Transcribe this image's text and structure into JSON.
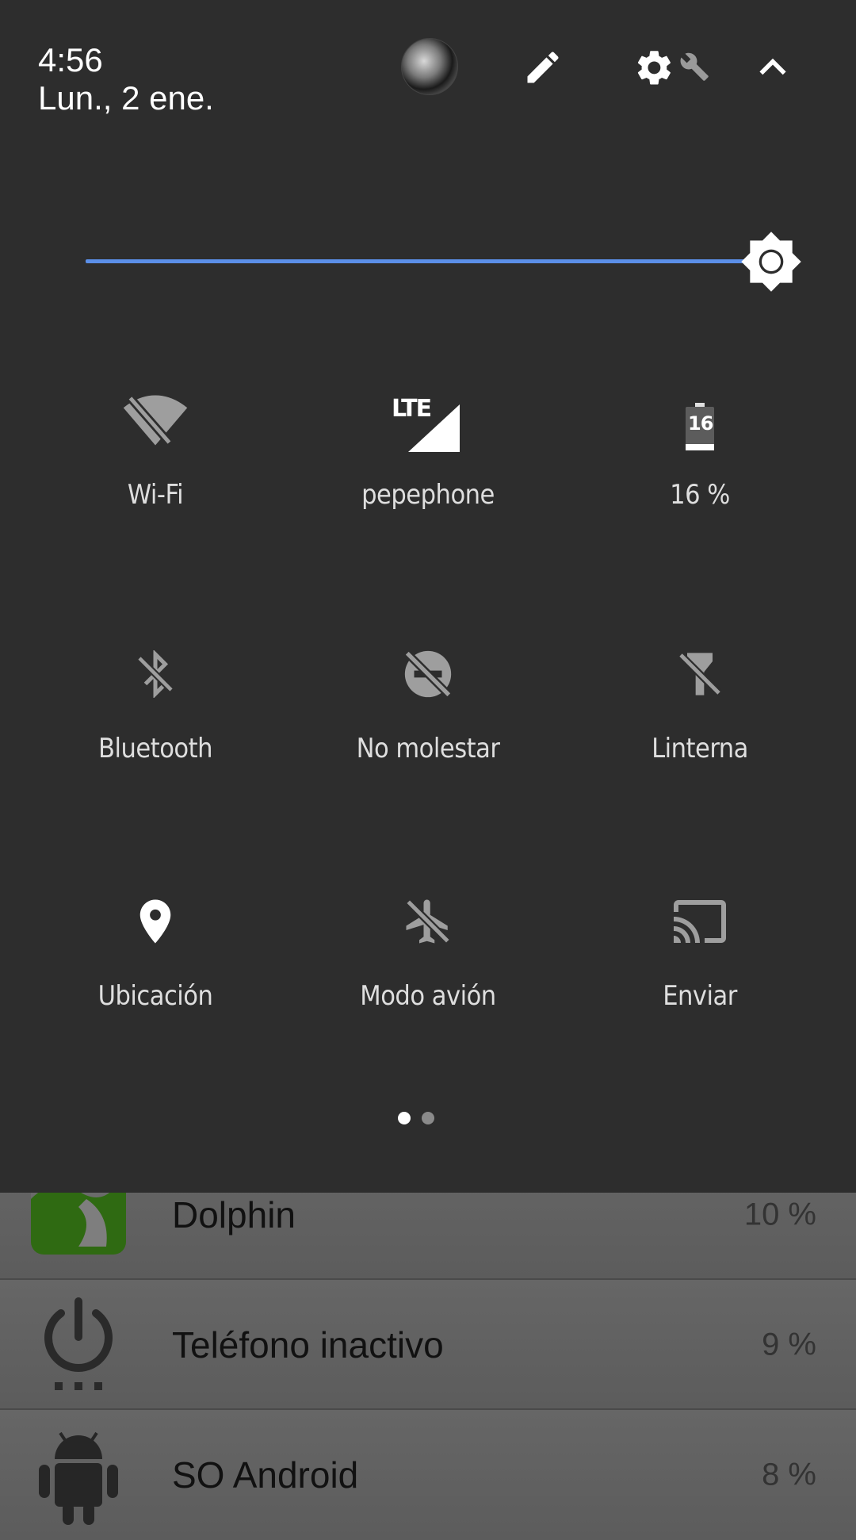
{
  "header": {
    "time": "4:56",
    "date": "Lun., 2 ene.",
    "avatar_icon": "user-avatar",
    "edit_icon": "pencil-icon",
    "settings_icon": "gear-wrench-icon",
    "collapse_icon": "chevron-up-icon"
  },
  "brightness": {
    "level": 1.0,
    "accent": "#5b8fe8"
  },
  "tiles": [
    {
      "label": "Wi-Fi",
      "icon": "wifi-off-icon",
      "active": false
    },
    {
      "label": "pepephone",
      "icon": "lte-signal-icon",
      "badge": "LTE",
      "active": true
    },
    {
      "label": "16 %",
      "icon": "battery-icon",
      "badge": "16",
      "active": true
    },
    {
      "label": "Bluetooth",
      "icon": "bluetooth-off-icon",
      "active": false
    },
    {
      "label": "No molestar",
      "icon": "do-not-disturb-off-icon",
      "active": false
    },
    {
      "label": "Linterna",
      "icon": "flashlight-off-icon",
      "active": false
    },
    {
      "label": "Ubicación",
      "icon": "location-icon",
      "active": true
    },
    {
      "label": "Modo avión",
      "icon": "airplane-off-icon",
      "active": false
    },
    {
      "label": "Enviar",
      "icon": "cast-icon",
      "active": false
    }
  ],
  "pager": {
    "pages": 2,
    "current": 1
  },
  "battery_list": [
    {
      "name": "Dolphin",
      "percent": "10 %",
      "icon": "dolphin-app-icon"
    },
    {
      "name": "Teléfono inactivo",
      "percent": "9 %",
      "icon": "power-idle-icon"
    },
    {
      "name": "SO Android",
      "percent": "8 %",
      "icon": "android-icon"
    }
  ]
}
